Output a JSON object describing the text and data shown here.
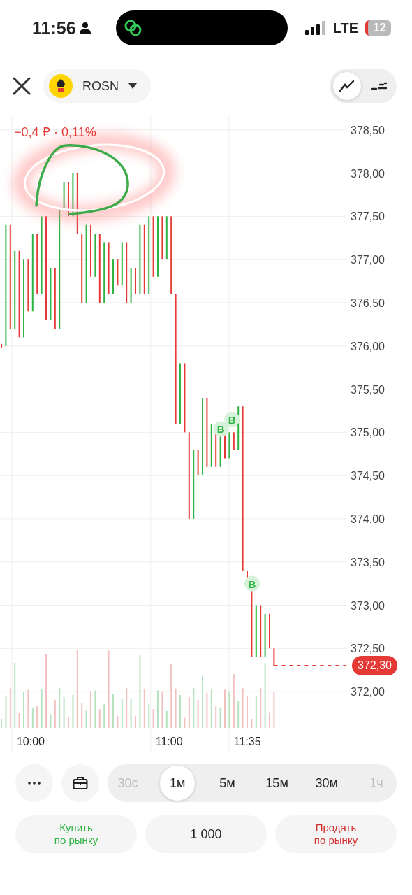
{
  "status_bar": {
    "time": "11:56",
    "network": "LTE",
    "battery": "12"
  },
  "header": {
    "ticker": "ROSN",
    "chart_modes": [
      {
        "kind": "line",
        "selected": true
      },
      {
        "kind": "dashed",
        "selected": false
      }
    ]
  },
  "change": "−0,4 ₽ · 0,11%",
  "chart": {
    "price_labels": [
      "378,50",
      "378,00",
      "377,50",
      "377,00",
      "376,50",
      "376,00",
      "375,50",
      "375,00",
      "374,50",
      "374,00",
      "373,50",
      "373,00",
      "372,50",
      "372,00"
    ],
    "time_labels": [
      "10:00",
      "11:00",
      "11:35"
    ],
    "markers": [
      "B",
      "B",
      "B"
    ],
    "last_price": "372,30"
  },
  "intervals": [
    {
      "label": "30с",
      "selected": false,
      "disabled": true
    },
    {
      "label": "1м",
      "selected": true,
      "disabled": false
    },
    {
      "label": "5м",
      "selected": false,
      "disabled": false
    },
    {
      "label": "15м",
      "selected": false,
      "disabled": false
    },
    {
      "label": "30м",
      "selected": false,
      "disabled": false
    },
    {
      "label": "1ч",
      "selected": false,
      "disabled": true
    }
  ],
  "actions": [
    {
      "kind": "buy",
      "lines": [
        "Купить",
        "по рынку"
      ]
    },
    {
      "kind": "quantity",
      "lines": [
        "1 000"
      ]
    },
    {
      "kind": "sell",
      "lines": [
        "Продать",
        "по рынку"
      ]
    }
  ]
}
